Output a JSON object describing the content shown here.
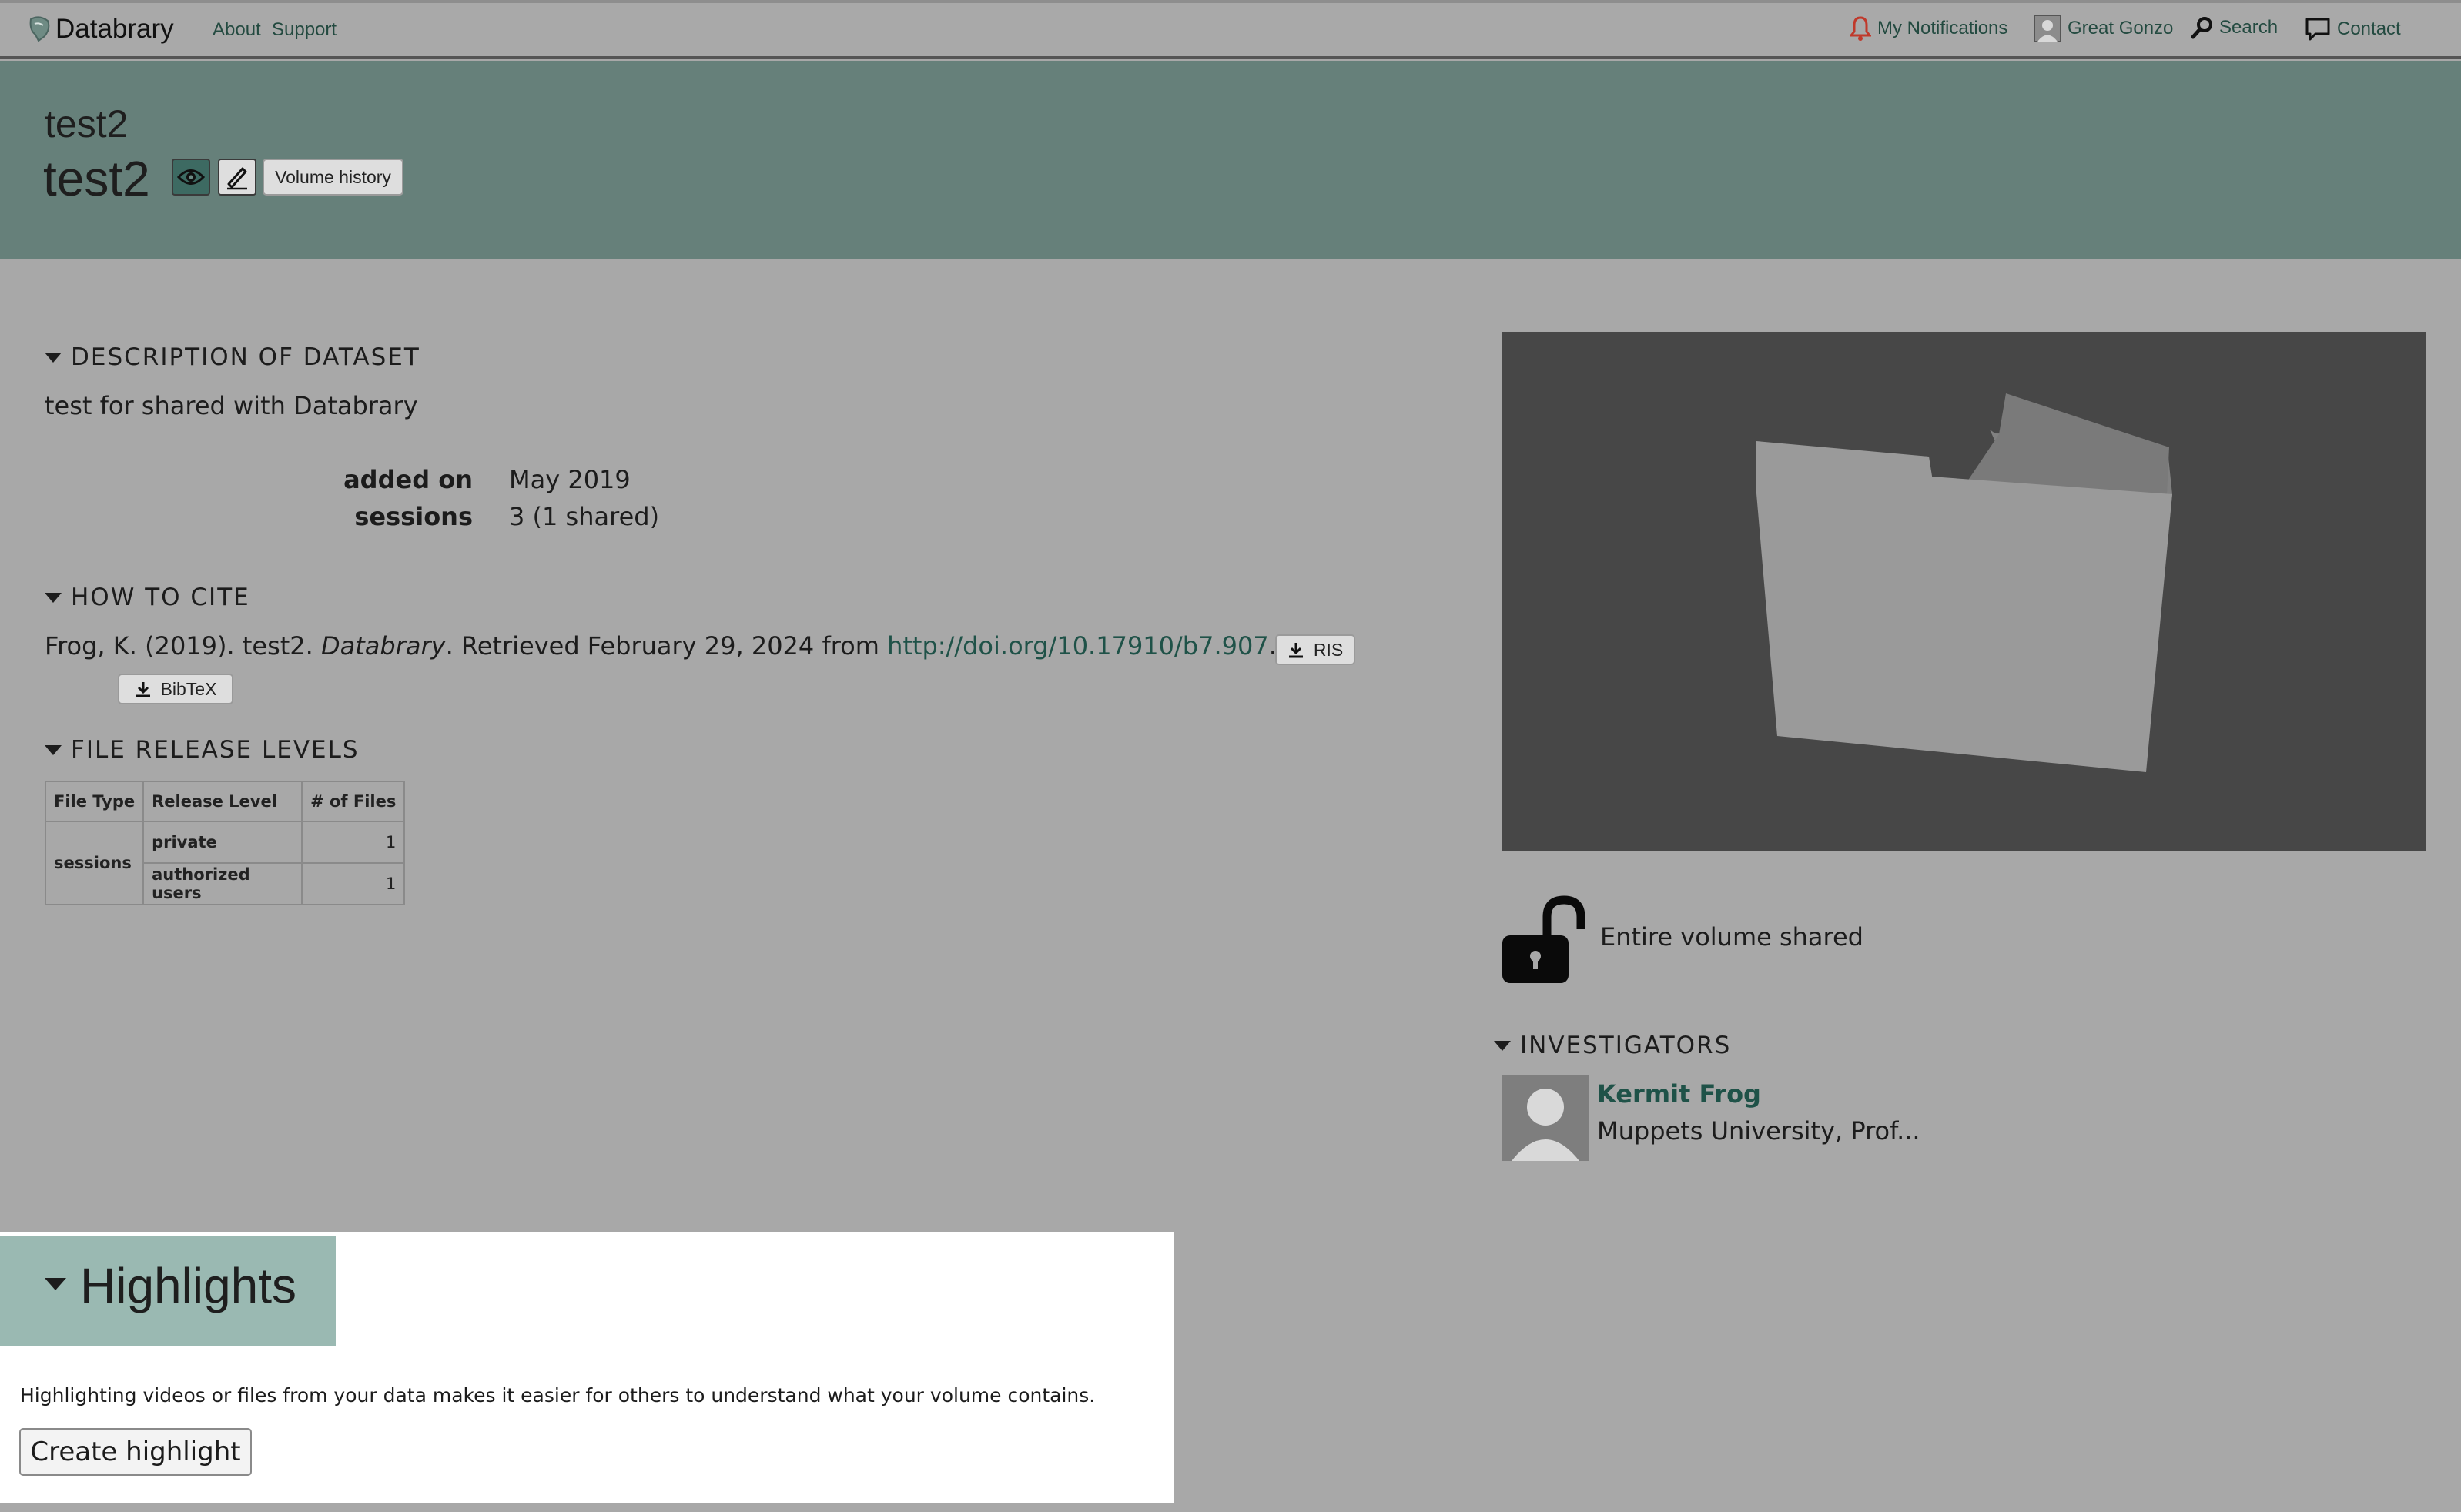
{
  "nav": {
    "brand": "Databrary",
    "about": "About",
    "support": "Support",
    "notifications": "My Notifications",
    "user": "Great Gonzo",
    "search": "Search",
    "contact": "Contact"
  },
  "volume": {
    "subtitle": "test2",
    "title": "test2",
    "history_button": "Volume history"
  },
  "description": {
    "heading": "DESCRIPTION OF DATASET",
    "text": "test for shared with Databrary",
    "added_on_label": "added on",
    "added_on_value": "May 2019",
    "sessions_label": "sessions",
    "sessions_value": "3 (1 shared)"
  },
  "citation": {
    "heading": "HOW TO CITE",
    "prefix": "Frog, K. (2019). test2.",
    "journal": "Databrary",
    "retrieved": ". Retrieved February 29, 2024 from",
    "doi": "http://doi.org/10.17910/b7.907",
    "period": ".",
    "ris_button": "RIS",
    "bibtex_button": "BibTeX"
  },
  "release": {
    "heading": "FILE RELEASE LEVELS",
    "columns": [
      "File Type",
      "Release Level",
      "# of Files"
    ],
    "group": "sessions",
    "rows": [
      {
        "level": "private",
        "count": "1"
      },
      {
        "level": "authorized users",
        "count": "1"
      }
    ]
  },
  "sharing": {
    "status": "Entire volume shared"
  },
  "investigators": {
    "heading": "INVESTIGATORS",
    "items": [
      {
        "name": "Kermit Frog",
        "affiliation": "Muppets University, Prof..."
      }
    ]
  },
  "highlights": {
    "title": "Highlights",
    "description": "Highlighting videos or files from your data makes it easier for others to understand what your volume contains.",
    "create_button": "Create highlight"
  },
  "colors": {
    "header_band": "#66807a",
    "link": "#1f5248",
    "highlight_tab": "#9ab9b2",
    "notification_bell": "#c0392b"
  }
}
